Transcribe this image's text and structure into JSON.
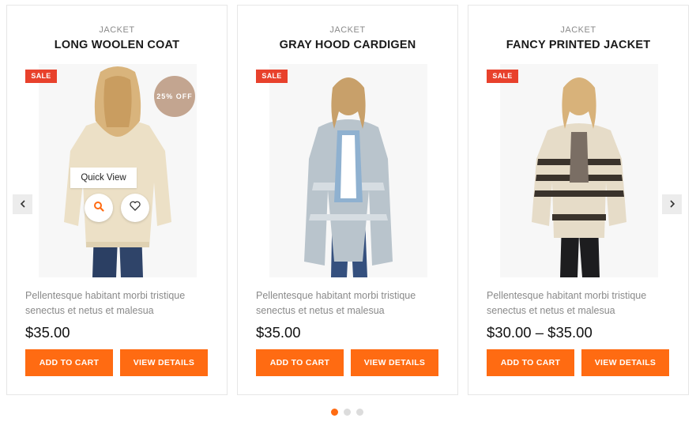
{
  "products": [
    {
      "category": "JACKET",
      "title": "LONG WOOLEN COAT",
      "sale_label": "SALE",
      "discount_label": "25% OFF",
      "quick_view_label": "Quick View",
      "description": "Pellentesque habitant morbi tristique senectus et netus et malesua",
      "price": "$35.00",
      "add_to_cart_label": "ADD TO CART",
      "view_details_label": "VIEW DETAILS"
    },
    {
      "category": "JACKET",
      "title": "GRAY HOOD CARDIGEN",
      "sale_label": "SALE",
      "description": "Pellentesque habitant morbi tristique senectus et netus et malesua",
      "price": "$35.00",
      "add_to_cart_label": "ADD TO CART",
      "view_details_label": "VIEW DETAILS"
    },
    {
      "category": "JACKET",
      "title": "FANCY PRINTED JACKET",
      "sale_label": "SALE",
      "description": "Pellentesque habitant morbi tristique senectus et netus et malesua",
      "price": "$30.00 – $35.00",
      "add_to_cart_label": "ADD TO CART",
      "view_details_label": "VIEW DETAILS"
    }
  ],
  "icons": {
    "prev": "chevron-left-icon",
    "next": "chevron-right-icon",
    "quick_view": "search-icon",
    "wishlist": "heart-icon"
  },
  "pagination": {
    "total": 3,
    "active": 1
  },
  "colors": {
    "accent": "#ff6b12",
    "sale": "#e8412c",
    "discount": "#c3a590",
    "text_muted": "#8a8a8a"
  }
}
